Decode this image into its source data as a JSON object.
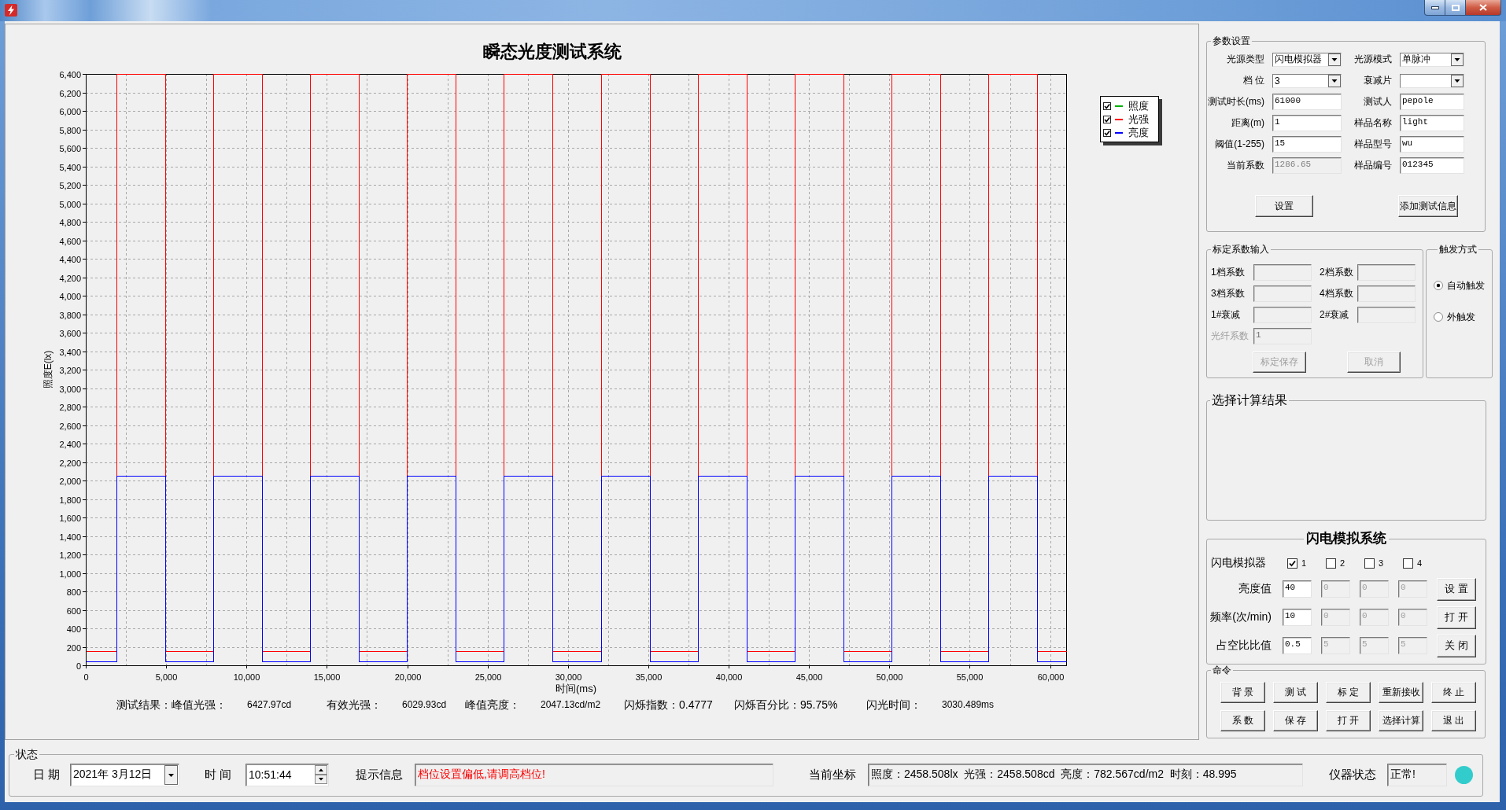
{
  "chart": {
    "chart_data": {
      "type": "line",
      "title": "瞬态光度测试系统",
      "xlabel": "时间(ms)",
      "ylabel": "照度E(lx)",
      "grid": true,
      "x": [
        0,
        1900,
        1900,
        4930,
        4930,
        7930,
        7930,
        10960,
        10960,
        13960,
        13960,
        16990,
        16990,
        19990,
        19990,
        23020,
        23020,
        26020,
        26020,
        29050,
        29050,
        32050,
        32050,
        35080,
        35080,
        38080,
        38080,
        41110,
        41110,
        44110,
        44110,
        47140,
        47140,
        50140,
        50140,
        53170,
        53170,
        56170,
        56170,
        59200,
        59200,
        61000
      ],
      "series": [
        {
          "color": "#ff0000",
          "values": [
            150,
            150,
            6400,
            6400,
            150,
            150,
            6400,
            6400,
            150,
            150,
            6400,
            6400,
            150,
            150,
            6400,
            6400,
            150,
            150,
            6400,
            6400,
            150,
            150,
            6400,
            6400,
            150,
            150,
            6400,
            6400,
            150,
            150,
            6400,
            6400,
            150,
            150,
            6400,
            6400,
            150,
            150,
            6400,
            6400,
            150,
            150
          ]
        },
        {
          "color": "#0000ff",
          "values": [
            40,
            40,
            2050,
            2050,
            40,
            40,
            2050,
            2050,
            40,
            40,
            2050,
            2050,
            40,
            40,
            2050,
            2050,
            40,
            40,
            2050,
            2050,
            40,
            40,
            2050,
            2050,
            40,
            40,
            2050,
            2050,
            40,
            40,
            2050,
            2050,
            40,
            40,
            2050,
            2050,
            40,
            40,
            2050,
            2050,
            40,
            40
          ]
        }
      ],
      "xlim": [
        0,
        61000
      ],
      "ylim": [
        0,
        6400
      ],
      "xticks": [
        0,
        {
          "value": 5000,
          "label": "5,000"
        },
        {
          "value": 10000,
          "label": "10,000"
        },
        {
          "value": 15000,
          "label": "15,000"
        },
        {
          "value": 20000,
          "label": "20,000"
        },
        {
          "value": 25000,
          "label": "25,000"
        },
        {
          "value": 30000,
          "label": "30,000"
        },
        {
          "value": 35000,
          "label": "35,000"
        },
        {
          "value": 40000,
          "label": "40,000"
        },
        {
          "value": 45000,
          "label": "45,000"
        },
        {
          "value": 50000,
          "label": "50,000"
        },
        {
          "value": 55000,
          "label": "55,000"
        },
        {
          "value": 60000,
          "label": "60,000"
        }
      ],
      "yticks": [
        0,
        200,
        400,
        600,
        800,
        {
          "value": 1000,
          "label": "1,000"
        },
        {
          "value": 1200,
          "label": "1,200"
        },
        {
          "value": 1400,
          "label": "1,400"
        },
        {
          "value": 1600,
          "label": "1,600"
        },
        {
          "value": 1800,
          "label": "1,800"
        },
        {
          "value": 2000,
          "label": "2,000"
        },
        {
          "value": 2200,
          "label": "2,200"
        },
        {
          "value": 2400,
          "label": "2,400"
        },
        {
          "value": 2600,
          "label": "2,600"
        },
        {
          "value": 2800,
          "label": "2,800"
        },
        {
          "value": 3000,
          "label": "3,000"
        },
        {
          "value": 3200,
          "label": "3,200"
        },
        {
          "value": 3400,
          "label": "3,400"
        },
        {
          "value": 3600,
          "label": "3,600"
        },
        {
          "value": 3800,
          "label": "3,800"
        },
        {
          "value": 4000,
          "label": "4,000"
        },
        {
          "value": 4200,
          "label": "4,200"
        },
        {
          "value": 4400,
          "label": "4,400"
        },
        {
          "value": 4600,
          "label": "4,600"
        },
        {
          "value": 4800,
          "label": "4,800"
        },
        {
          "value": 5000,
          "label": "5,000"
        },
        {
          "value": 5200,
          "label": "5,200"
        },
        {
          "value": 5400,
          "label": "5,400"
        },
        {
          "value": 5600,
          "label": "5,600"
        },
        {
          "value": 5800,
          "label": "5,800"
        },
        {
          "value": 6000,
          "label": "6,000"
        },
        {
          "value": 6200,
          "label": "6,200"
        },
        {
          "value": 6400,
          "label": "6,400"
        }
      ]
    },
    "legend": [
      {
        "label": "照度",
        "color": "#00b000",
        "checked": true
      },
      {
        "label": "光强",
        "color": "#ff0000",
        "checked": true
      },
      {
        "label": "亮度",
        "color": "#0000ff",
        "checked": true
      }
    ],
    "results": [
      {
        "label": "测试结果：峰值光强：",
        "value": "6427.97cd"
      },
      {
        "label": "有效光强：",
        "value": "6029.93cd"
      },
      {
        "label": "峰值亮度：",
        "value": "2047.13cd/m2"
      },
      {
        "label": "闪烁指数：0.4777"
      },
      {
        "label": "闪烁百分比：95.75%"
      },
      {
        "label": "闪光时间：",
        "value": "3030.489ms"
      }
    ]
  },
  "parameters": {
    "title": "参数设置",
    "fields": [
      {
        "kind": "select",
        "label": "光源类型",
        "value": "闪电模拟器",
        "readonly": false
      },
      {
        "kind": "select",
        "label": "光源模式",
        "value": "单脉冲",
        "readonly": false
      },
      {
        "kind": "select",
        "label": "档 位",
        "value": "3",
        "readonly": false
      },
      {
        "kind": "select",
        "label": "衰减片",
        "readonly": false
      },
      {
        "kind": "input",
        "label": "测试时长(ms)",
        "value": "61000",
        "readonly": false
      },
      {
        "kind": "input",
        "label": "测试人",
        "value": "pepole",
        "readonly": false
      },
      {
        "kind": "input",
        "label": "距离(m)",
        "value": "1",
        "readonly": false
      },
      {
        "kind": "input",
        "label": "样品名称",
        "value": "light",
        "readonly": false
      },
      {
        "kind": "input",
        "label": "阈值(1-255)",
        "value": "15",
        "readonly": false
      },
      {
        "kind": "input",
        "label": "样品型号",
        "value": "wu",
        "readonly": false
      },
      {
        "kind": "input",
        "label": "当前系数",
        "value": "1286.65",
        "readonly": true
      },
      {
        "kind": "input",
        "label": "样品编号",
        "value": "012345",
        "readonly": false
      }
    ],
    "buttons": [
      "设置",
      "添加测试信息"
    ]
  },
  "calibration": {
    "title": "标定系数输入",
    "fields": [
      {
        "label": "1档系数",
        "readonly": true,
        "disabled": false
      },
      {
        "label": "2档系数",
        "readonly": true,
        "disabled": false
      },
      {
        "label": "3档系数",
        "readonly": true,
        "disabled": false
      },
      {
        "label": "4档系数",
        "readonly": true,
        "disabled": false
      },
      {
        "label": "1#衰减",
        "readonly": true,
        "disabled": false
      },
      {
        "label": "2#衰减",
        "readonly": true,
        "disabled": false
      },
      {
        "label": "光纤系数",
        "value": "1",
        "readonly": false,
        "disabled": true
      }
    ],
    "buttons": [
      {
        "label": "标定保存",
        "disabled": true
      },
      {
        "label": "取消",
        "disabled": true
      }
    ]
  },
  "trigger": {
    "title": "触发方式",
    "options": [
      {
        "label": "自动触发",
        "selected": true
      },
      {
        "label": "外触发",
        "selected": false
      }
    ]
  },
  "calc_results": {
    "title": "选择计算结果"
  },
  "simulator": {
    "title": "闪电模拟系统",
    "device_label": "闪电模拟器",
    "channels": [
      {
        "label": "1",
        "checked": true
      },
      {
        "label": "2",
        "checked": false
      },
      {
        "label": "3",
        "checked": false
      },
      {
        "label": "4",
        "checked": false
      }
    ],
    "rows": [
      {
        "label": "亮度值",
        "cells": [
          {
            "value": "40",
            "disabled": false
          },
          {
            "value": "0",
            "disabled": true
          },
          {
            "value": "0",
            "disabled": true
          },
          {
            "value": "0",
            "disabled": true
          }
        ],
        "button": "设 置"
      },
      {
        "label": "频率(次/min)",
        "cells": [
          {
            "value": "10",
            "disabled": false
          },
          {
            "value": "0",
            "disabled": true
          },
          {
            "value": "0",
            "disabled": true
          },
          {
            "value": "0",
            "disabled": true
          }
        ],
        "button": "打 开"
      },
      {
        "label": "占空比比值",
        "cells": [
          {
            "value": "0.5",
            "disabled": false
          },
          {
            "value": "5",
            "disabled": true
          },
          {
            "value": "5",
            "disabled": true
          },
          {
            "value": "5",
            "disabled": true
          }
        ],
        "button": "关 闭"
      }
    ]
  },
  "commands": {
    "title": "命令",
    "buttons": [
      "背 景",
      "测 试",
      "标 定",
      "重新接收",
      "终 止",
      "系 数",
      "保 存",
      "打 开",
      "选择计算",
      "退 出"
    ]
  },
  "status": {
    "title": "状态",
    "date_label": "日 期",
    "date": "2021年 3月12日",
    "time_label": "时 间",
    "time": "10:51:44",
    "hint_label": "提示信息",
    "hint": "档位设置偏低,请调高档位!",
    "coord_label": "当前坐标",
    "coord": "照度：2458.508lx  光强：2458.508cd  亮度：782.567cd/m2  时刻：48.995",
    "instrument_label": "仪器状态",
    "instrument": "正常!",
    "indicator": {
      "color": "#33cccc"
    }
  }
}
